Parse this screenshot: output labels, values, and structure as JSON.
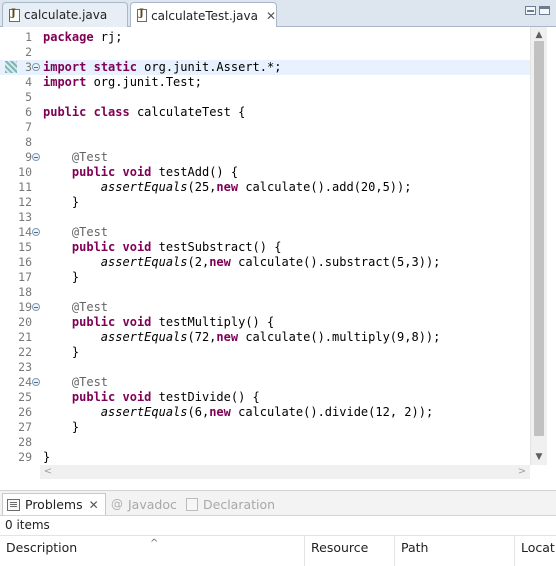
{
  "editor_tabs": [
    {
      "label": "calculate.java",
      "active": false
    },
    {
      "label": "calculateTest.java",
      "active": true
    }
  ],
  "close_glyph": "✕",
  "code_lines": [
    {
      "n": "1",
      "html": "<span class=\"kw\">package</span> rj;"
    },
    {
      "n": "2",
      "html": ""
    },
    {
      "n": "3",
      "html": "<span class=\"kw\">import</span> <span class=\"kw\">static</span> org.junit.Assert.*;",
      "fold": true,
      "current": true,
      "mark": true
    },
    {
      "n": "4",
      "html": "<span class=\"kw\">import</span> org.junit.Test;"
    },
    {
      "n": "5",
      "html": ""
    },
    {
      "n": "6",
      "html": "<span class=\"kw\">public</span> <span class=\"kw\">class</span> calculateTest {"
    },
    {
      "n": "7",
      "html": ""
    },
    {
      "n": "8",
      "html": ""
    },
    {
      "n": "9",
      "html": "    <span class=\"ann\">@Test</span>",
      "fold": true
    },
    {
      "n": "10",
      "html": "    <span class=\"kw\">public</span> <span class=\"kw\">void</span> testAdd() {"
    },
    {
      "n": "11",
      "html": "        <span class=\"it\">assertEquals</span>(25,<span class=\"kw\">new</span> calculate().add(20,5));"
    },
    {
      "n": "12",
      "html": "    }"
    },
    {
      "n": "13",
      "html": ""
    },
    {
      "n": "14",
      "html": "    <span class=\"ann\">@Test</span>",
      "fold": true
    },
    {
      "n": "15",
      "html": "    <span class=\"kw\">public</span> <span class=\"kw\">void</span> testSubstract() {"
    },
    {
      "n": "16",
      "html": "        <span class=\"it\">assertEquals</span>(2,<span class=\"kw\">new</span> calculate().substract(5,3));"
    },
    {
      "n": "17",
      "html": "    }"
    },
    {
      "n": "18",
      "html": ""
    },
    {
      "n": "19",
      "html": "    <span class=\"ann\">@Test</span>",
      "fold": true
    },
    {
      "n": "20",
      "html": "    <span class=\"kw\">public</span> <span class=\"kw\">void</span> testMultiply() {"
    },
    {
      "n": "21",
      "html": "        <span class=\"it\">assertEquals</span>(72,<span class=\"kw\">new</span> calculate().multiply(9,8));"
    },
    {
      "n": "22",
      "html": "    }"
    },
    {
      "n": "23",
      "html": ""
    },
    {
      "n": "24",
      "html": "    <span class=\"ann\">@Test</span>",
      "fold": true
    },
    {
      "n": "25",
      "html": "    <span class=\"kw\">public</span> <span class=\"kw\">void</span> testDivide() {"
    },
    {
      "n": "26",
      "html": "        <span class=\"it\">assertEquals</span>(6,<span class=\"kw\">new</span> calculate().divide(12, 2));"
    },
    {
      "n": "27",
      "html": "    }"
    },
    {
      "n": "28",
      "html": ""
    },
    {
      "n": "29",
      "html": "}"
    }
  ],
  "bottom_panel": {
    "tabs": [
      {
        "label": "Problems",
        "active": true,
        "icon": "problems-icon"
      },
      {
        "label": "Javadoc",
        "active": false,
        "icon": "javadoc-icon"
      },
      {
        "label": "Declaration",
        "active": false,
        "icon": "declaration-icon"
      }
    ],
    "items_count": "0 items",
    "columns": [
      "Description",
      "Resource",
      "Path",
      "Location"
    ]
  },
  "colors": {
    "keyword": "#7f0055",
    "annotation": "#646464",
    "current_line": "#e8f2fe",
    "tab_bar": "#dde5ef"
  }
}
